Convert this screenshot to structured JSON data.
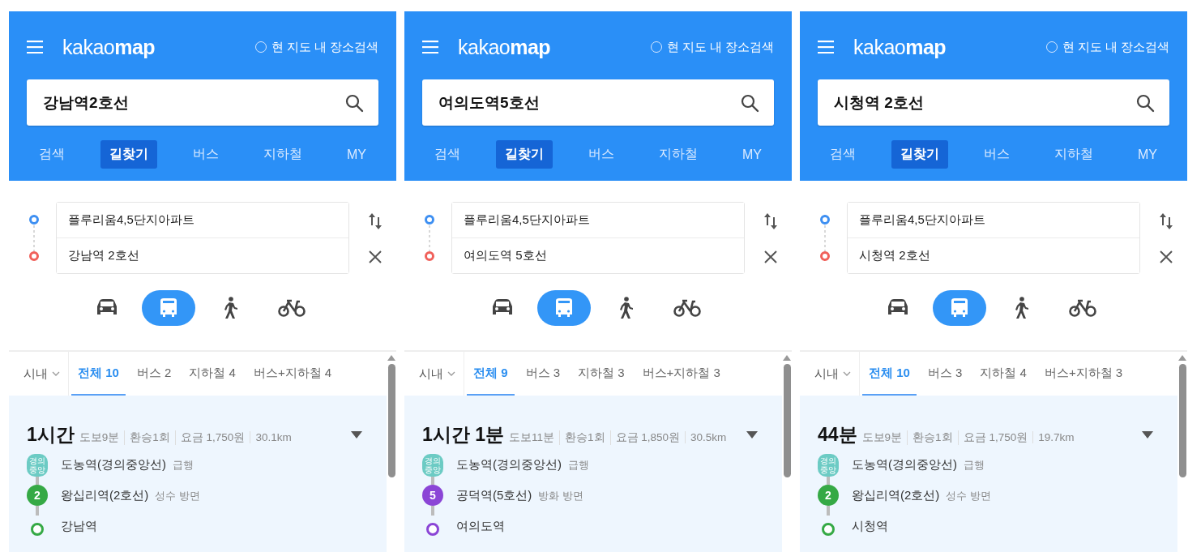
{
  "panels": [
    {
      "header": {
        "logo": "kakao**map**",
        "local_search": {
          "label": "현 지도 내 장소검색",
          "checked": false
        },
        "query": "강남역2호선",
        "nav": [
          {
            "label": "검색",
            "selected": false
          },
          {
            "label": "길찾기",
            "selected": true
          },
          {
            "label": "버스",
            "selected": false
          },
          {
            "label": "지하철",
            "selected": false
          },
          {
            "label": "MY",
            "selected": false
          }
        ]
      },
      "route": {
        "origin": "플루리움4,5단지아파트",
        "destination": "강남역 2호선"
      },
      "modes": [
        {
          "kind": "car",
          "selected": false
        },
        {
          "kind": "bus",
          "selected": true
        },
        {
          "kind": "walk",
          "selected": false
        },
        {
          "kind": "bike",
          "selected": false
        }
      ],
      "filters": {
        "region": "시내",
        "tabs": [
          {
            "label": "전체 10",
            "selected": true
          },
          {
            "label": "버스 2",
            "selected": false
          },
          {
            "label": "지하철 4",
            "selected": false
          },
          {
            "label": "버스+지하철 4",
            "selected": false
          }
        ]
      },
      "result": {
        "duration": "1시간",
        "meta": [
          "도보9분",
          "환승1회",
          "요금 1,750원",
          "30.1km"
        ],
        "steps": [
          {
            "kind": "tag",
            "badge": "경의중앙",
            "color": "#6ccbc4",
            "station": "도농역(경의중앙선)",
            "note": "급행"
          },
          {
            "kind": "number",
            "badge": "2",
            "color": "#35a945",
            "station": "왕십리역(2호선)",
            "note": "성수 방면"
          },
          {
            "kind": "end",
            "color": "#35a945",
            "station": "강남역"
          }
        ]
      }
    },
    {
      "header": {
        "logo": "kakao**map**",
        "local_search": {
          "label": "현 지도 내 장소검색",
          "checked": false
        },
        "query": "여의도역5호선",
        "nav": [
          {
            "label": "검색",
            "selected": false
          },
          {
            "label": "길찾기",
            "selected": true
          },
          {
            "label": "버스",
            "selected": false
          },
          {
            "label": "지하철",
            "selected": false
          },
          {
            "label": "MY",
            "selected": false
          }
        ]
      },
      "route": {
        "origin": "플루리움4,5단지아파트",
        "destination": "여의도역 5호선"
      },
      "modes": [
        {
          "kind": "car",
          "selected": false
        },
        {
          "kind": "bus",
          "selected": true
        },
        {
          "kind": "walk",
          "selected": false
        },
        {
          "kind": "bike",
          "selected": false
        }
      ],
      "filters": {
        "region": "시내",
        "tabs": [
          {
            "label": "전체 9",
            "selected": true
          },
          {
            "label": "버스 3",
            "selected": false
          },
          {
            "label": "지하철 3",
            "selected": false
          },
          {
            "label": "버스+지하철 3",
            "selected": false
          }
        ]
      },
      "result": {
        "duration": "1시간 1분",
        "meta": [
          "도보11분",
          "환승1회",
          "요금 1,850원",
          "30.5km"
        ],
        "steps": [
          {
            "kind": "tag",
            "badge": "경의중앙",
            "color": "#6ccbc4",
            "station": "도농역(경의중앙선)",
            "note": "급행"
          },
          {
            "kind": "number",
            "badge": "5",
            "color": "#8b45d6",
            "station": "공덕역(5호선)",
            "note": "방화 방면"
          },
          {
            "kind": "end",
            "color": "#8b45d6",
            "station": "여의도역"
          }
        ]
      }
    },
    {
      "header": {
        "logo": "kakao**map**",
        "local_search": {
          "label": "현 지도 내 장소검색",
          "checked": false
        },
        "query": "시청역 2호선",
        "nav": [
          {
            "label": "검색",
            "selected": false
          },
          {
            "label": "길찾기",
            "selected": true
          },
          {
            "label": "버스",
            "selected": false
          },
          {
            "label": "지하철",
            "selected": false
          },
          {
            "label": "MY",
            "selected": false
          }
        ]
      },
      "route": {
        "origin": "플루리움4,5단지아파트",
        "destination": "시청역 2호선"
      },
      "modes": [
        {
          "kind": "car",
          "selected": false
        },
        {
          "kind": "bus",
          "selected": true
        },
        {
          "kind": "walk",
          "selected": false
        },
        {
          "kind": "bike",
          "selected": false
        }
      ],
      "filters": {
        "region": "시내",
        "tabs": [
          {
            "label": "전체 10",
            "selected": true
          },
          {
            "label": "버스 3",
            "selected": false
          },
          {
            "label": "지하철 4",
            "selected": false
          },
          {
            "label": "버스+지하철 3",
            "selected": false
          }
        ]
      },
      "result": {
        "duration": "44분",
        "meta": [
          "도보9분",
          "환승1회",
          "요금 1,750원",
          "19.7km"
        ],
        "steps": [
          {
            "kind": "tag",
            "badge": "경의중앙",
            "color": "#6ccbc4",
            "station": "도농역(경의중앙선)",
            "note": "급행"
          },
          {
            "kind": "number",
            "badge": "2",
            "color": "#35a945",
            "station": "왕십리역(2호선)",
            "note": "성수 방면"
          },
          {
            "kind": "end",
            "color": "#35a945",
            "station": "시청역"
          }
        ]
      }
    }
  ]
}
